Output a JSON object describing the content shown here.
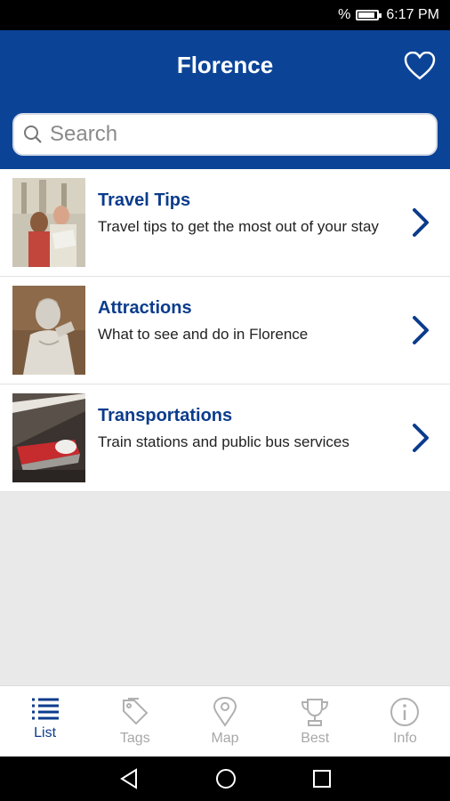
{
  "status_bar": {
    "battery_pct": "%",
    "time": "6:17 PM"
  },
  "app_bar": {
    "title": "Florence"
  },
  "search": {
    "placeholder": "Search"
  },
  "items": [
    {
      "title": "Travel Tips",
      "subtitle": "Travel tips to get the most out of your stay",
      "image": "tourists-photo"
    },
    {
      "title": "Attractions",
      "subtitle": "What to see and do in Florence",
      "image": "david-statue-photo"
    },
    {
      "title": "Transportations",
      "subtitle": "Train stations and public bus services",
      "image": "train-station-photo"
    }
  ],
  "bottom_nav": [
    {
      "label": "List",
      "icon": "list-icon",
      "active": true
    },
    {
      "label": "Tags",
      "icon": "tags-icon",
      "active": false
    },
    {
      "label": "Map",
      "icon": "map-pin-icon",
      "active": false
    },
    {
      "label": "Best",
      "icon": "trophy-icon",
      "active": false
    },
    {
      "label": "Info",
      "icon": "info-icon",
      "active": false
    }
  ],
  "colors": {
    "primary": "#0b4497",
    "accent_text": "#0b3c8c",
    "inactive": "#a8a8a8",
    "background": "#e9e9e9"
  }
}
